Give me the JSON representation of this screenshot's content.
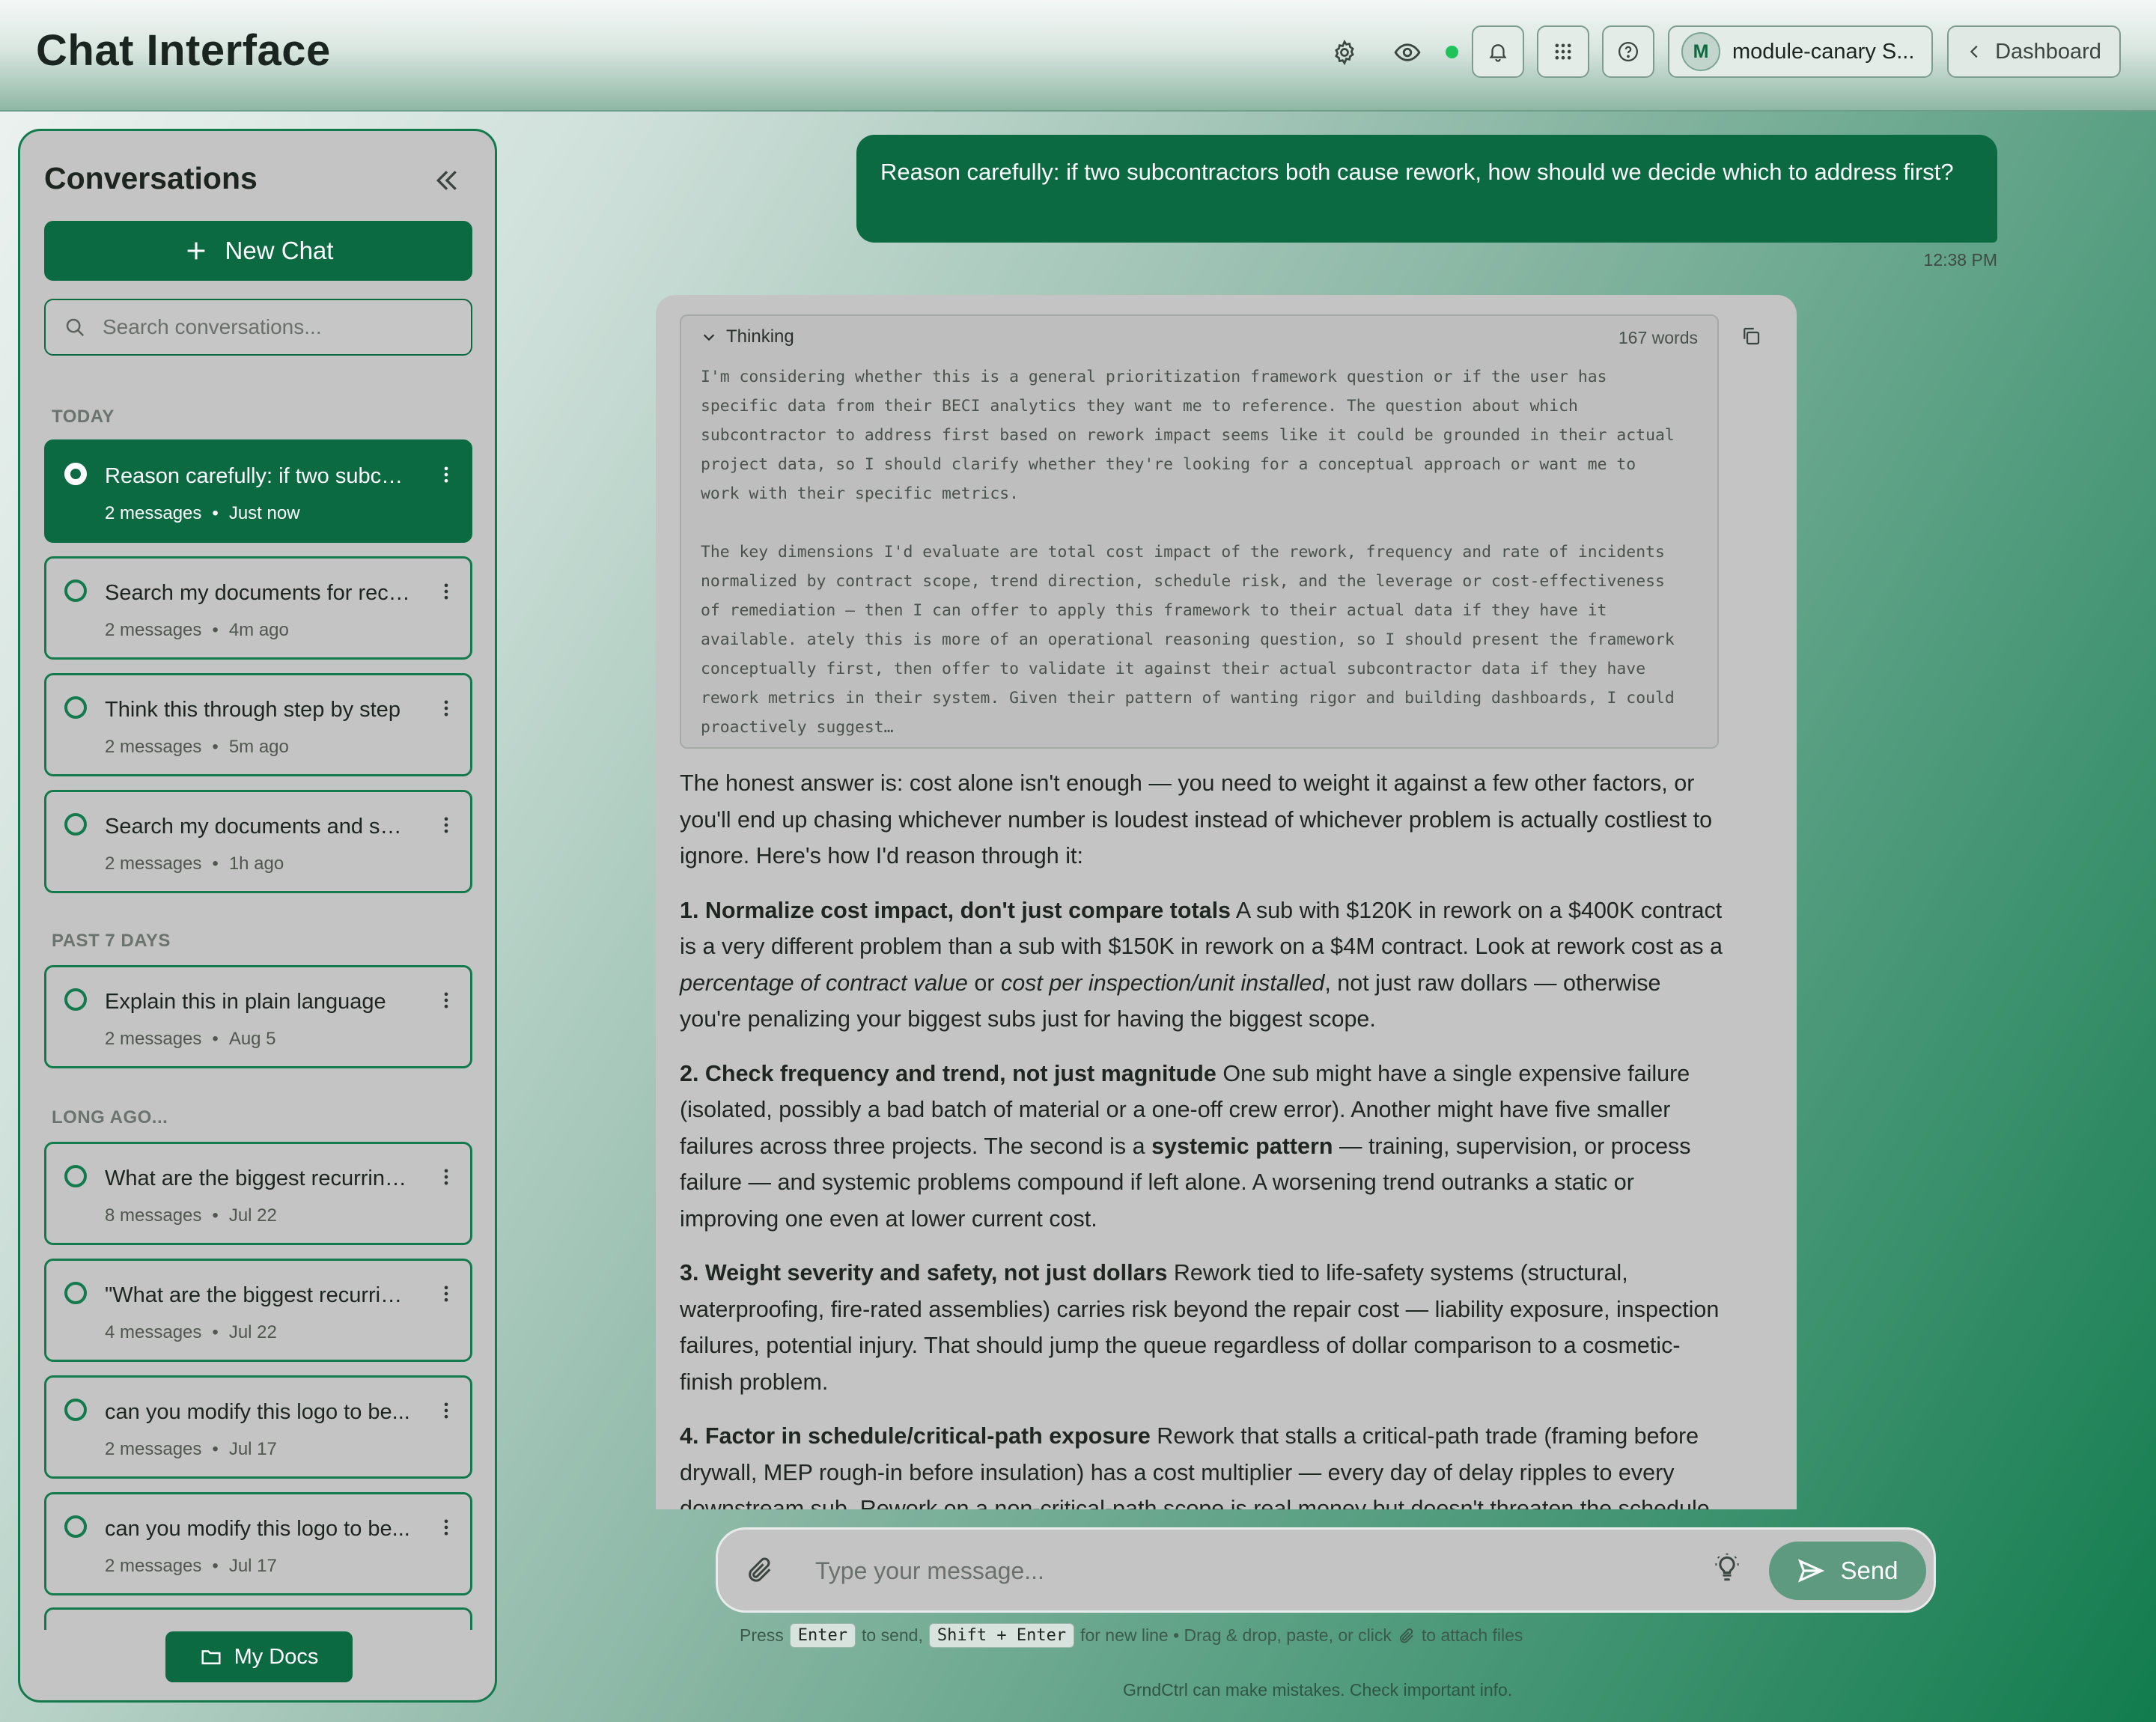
{
  "header": {
    "title": "Chat Interface",
    "workspace_initial": "M",
    "workspace_name": "module-canary S...",
    "dashboard_label": "Dashboard"
  },
  "sidebar": {
    "title": "Conversations",
    "new_chat_label": "New Chat",
    "search_placeholder": "Search conversations...",
    "groups": [
      {
        "label": "TODAY",
        "items": [
          {
            "title": "Reason carefully: if two subcontractors both cause rework...",
            "messages": "2 messages",
            "time": "Just now",
            "active": true
          },
          {
            "title": "Search my documents for recent rework reports",
            "messages": "2 messages",
            "time": "4m ago"
          },
          {
            "title": "Think this through step by step",
            "messages": "2 messages",
            "time": "5m ago"
          },
          {
            "title": "Search my documents and summarize",
            "messages": "2 messages",
            "time": "1h ago"
          }
        ]
      },
      {
        "label": "PAST 7 DAYS",
        "items": [
          {
            "title": "Explain this in plain language",
            "messages": "2 messages",
            "time": "Aug 5"
          }
        ]
      },
      {
        "label": "LONG AGO...",
        "items": [
          {
            "title": "What are the biggest recurring issues",
            "messages": "8 messages",
            "time": "Jul 22"
          },
          {
            "title": "\"What are the biggest recurring issues",
            "messages": "4 messages",
            "time": "Jul 22"
          },
          {
            "title": "can you modify this logo to be...",
            "messages": "2 messages",
            "time": "Jul 17"
          },
          {
            "title": "can you modify this logo to be...",
            "messages": "2 messages",
            "time": "Jul 17"
          }
        ]
      }
    ],
    "my_docs_label": "My Docs"
  },
  "conversation": {
    "user_message": "Reason carefully: if two subcontractors both cause rework, how should we decide which to address first?",
    "user_time": "12:38 PM",
    "thinking_label": "Thinking",
    "thinking_word_count": "167 words",
    "thinking_text": "I'm considering whether this is a general prioritization framework question or if the user has\nspecific data from their BECI analytics they want me to reference. The question about which\nsubcontractor to address first based on rework impact seems like it could be grounded in their actual\nproject data, so I should clarify whether they're looking for a conceptual approach or want me to\nwork with their specific metrics.\n\nThe key dimensions I'd evaluate are total cost impact of the rework, frequency and rate of incidents\nnormalized by contract scope, trend direction, schedule risk, and the leverage or cost-effectiveness\nof remediation — then I can offer to apply this framework to their actual data if they have it\navailable. ately this is more of an operational reasoning question, so I should present the framework\nconceptually first, then offer to validate it against their actual subcontractor data if they have\nrework metrics in their system. Given their pattern of wanting rigor and building dashboards, I could\nproactively suggest…",
    "answer_intro": "The honest answer is: cost alone isn't enough — you need to weight it against a few other factors, or you'll end up chasing whichever number is loudest instead of whichever problem is actually costliest to ignore. Here's how I'd reason through it:",
    "points": [
      {
        "heading": "1. Normalize cost impact, don't just compare totals",
        "t1": " A sub with $120K in rework on a $400K contract is a very different problem than a sub with $150K in rework on a $4M contract. Look at rework cost as a ",
        "i1": "percentage of contract value",
        "t2": " or ",
        "i2": "cost per inspection/unit installed",
        "t3": ", not just raw dollars — otherwise you're penalizing your biggest subs just for having the biggest scope."
      },
      {
        "heading": "2. Check frequency and trend, not just magnitude",
        "t1": " One sub might have a single expensive failure (isolated, possibly a bad batch of material or a one-off crew error). Another might have five smaller failures across three projects. The second is a ",
        "b1": "systemic pattern",
        "t2": " — training, supervision, or process failure — and systemic problems compound if left alone. A worsening trend outranks a static or improving one even at lower current cost."
      },
      {
        "heading": "3. Weight severity and safety, not just dollars",
        "t1": " Rework tied to life-safety systems (structural, waterproofing, fire-rated assemblies) carries risk beyond the repair cost — liability exposure, inspection failures, potential injury. That should jump the queue regardless of dollar comparison to a cosmetic-finish problem."
      },
      {
        "heading": "4. Factor in schedule/critical-path exposure",
        "t1": " Rework that stalls a critical-path trade (framing before drywall, MEP rough-in before insulation) has a cost multiplier — every day of delay ripples to every downstream sub. Rework on a non-critical-path scope is real money but doesn't threaten the schedule."
      }
    ]
  },
  "composer": {
    "placeholder": "Type your message...",
    "send_label": "Send",
    "hint_press": "Press",
    "hint_enter_key": "Enter",
    "hint_to_send": "to send,",
    "hint_shift_key": "Shift + Enter",
    "hint_rest": "for new line • Drag & drop, paste, or click",
    "hint_end": "to attach files",
    "disclaimer": "GrndCtrl can make mistakes. Check important info."
  },
  "colors": {
    "brand_green": "#0c6a43",
    "status_online": "#1fc35a"
  }
}
